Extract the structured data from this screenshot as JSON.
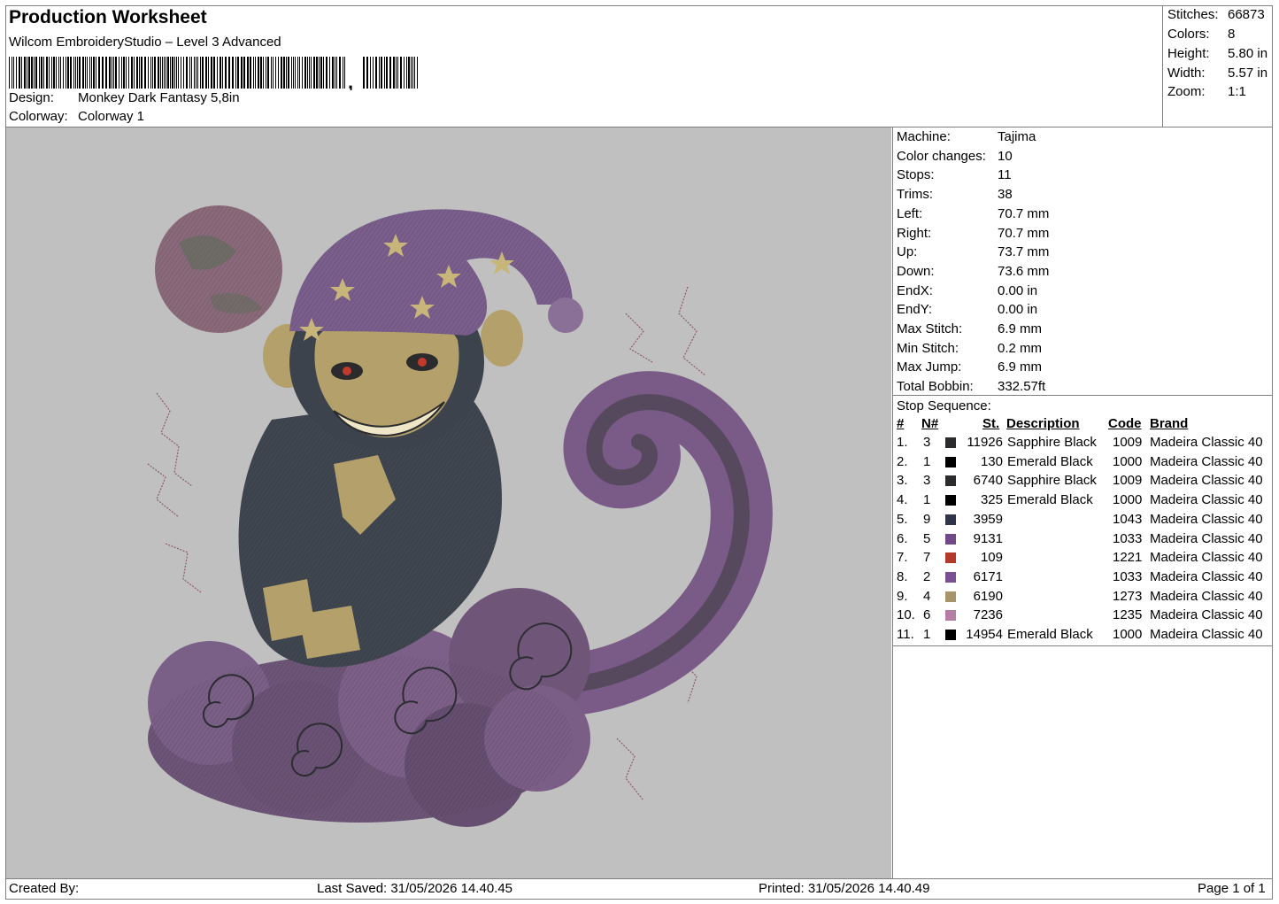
{
  "header": {
    "title": "Production Worksheet",
    "software": "Wilcom EmbroideryStudio – Level 3 Advanced",
    "barcode_suffix": ",",
    "design_label": "Design:",
    "design_value": "Monkey Dark Fantasy 5,8in",
    "colorway_label": "Colorway:",
    "colorway_value": "Colorway 1"
  },
  "stats": [
    {
      "label": "Stitches:",
      "value": "66873"
    },
    {
      "label": "Colors:",
      "value": "8"
    },
    {
      "label": "Height:",
      "value": "5.80 in"
    },
    {
      "label": "Width:",
      "value": "5.57 in"
    },
    {
      "label": "Zoom:",
      "value": "1:1"
    }
  ],
  "machine_info": [
    {
      "label": "Machine:",
      "value": "Tajima"
    },
    {
      "label": "Color changes:",
      "value": "10"
    },
    {
      "label": "Stops:",
      "value": "11"
    },
    {
      "label": "Trims:",
      "value": "38"
    },
    {
      "label": "Left:",
      "value": "70.7 mm"
    },
    {
      "label": "Right:",
      "value": "70.7 mm"
    },
    {
      "label": "Up:",
      "value": "73.7 mm"
    },
    {
      "label": "Down:",
      "value": "73.6 mm"
    },
    {
      "label": "EndX:",
      "value": "0.00 in"
    },
    {
      "label": "EndY:",
      "value": "0.00 in"
    },
    {
      "label": "Max Stitch:",
      "value": "6.9 mm"
    },
    {
      "label": "Min Stitch:",
      "value": "0.2 mm"
    },
    {
      "label": "Max Jump:",
      "value": "6.9 mm"
    },
    {
      "label": "Total Bobbin:",
      "value": "332.57ft"
    }
  ],
  "stop_sequence": {
    "title": "Stop Sequence:",
    "columns": {
      "num": "#",
      "needle": "N#",
      "stitches": "St.",
      "description": "Description",
      "code": "Code",
      "brand": "Brand"
    },
    "rows": [
      {
        "num": "1.",
        "needle": "3",
        "color": "#2b2b2e",
        "stitches": "11926",
        "description": "Sapphire Black",
        "code": "1009",
        "brand": "Madeira Classic 40"
      },
      {
        "num": "2.",
        "needle": "1",
        "color": "#000000",
        "stitches": "130",
        "description": "Emerald Black",
        "code": "1000",
        "brand": "Madeira Classic 40"
      },
      {
        "num": "3.",
        "needle": "3",
        "color": "#2b2b2e",
        "stitches": "6740",
        "description": "Sapphire Black",
        "code": "1009",
        "brand": "Madeira Classic 40"
      },
      {
        "num": "4.",
        "needle": "1",
        "color": "#000000",
        "stitches": "325",
        "description": "Emerald Black",
        "code": "1000",
        "brand": "Madeira Classic 40"
      },
      {
        "num": "5.",
        "needle": "9",
        "color": "#2f3446",
        "stitches": "3959",
        "description": "",
        "code": "1043",
        "brand": "Madeira Classic 40"
      },
      {
        "num": "6.",
        "needle": "5",
        "color": "#6f4a86",
        "stitches": "9131",
        "description": "",
        "code": "1033",
        "brand": "Madeira Classic 40"
      },
      {
        "num": "7.",
        "needle": "7",
        "color": "#b23a2c",
        "stitches": "109",
        "description": "",
        "code": "1221",
        "brand": "Madeira Classic 40"
      },
      {
        "num": "8.",
        "needle": "2",
        "color": "#7a4f94",
        "stitches": "6171",
        "description": "",
        "code": "1033",
        "brand": "Madeira Classic 40"
      },
      {
        "num": "9.",
        "needle": "4",
        "color": "#a8946a",
        "stitches": "6190",
        "description": "",
        "code": "1273",
        "brand": "Madeira Classic 40"
      },
      {
        "num": "10.",
        "needle": "6",
        "color": "#b57fa3",
        "stitches": "7236",
        "description": "",
        "code": "1235",
        "brand": "Madeira Classic 40"
      },
      {
        "num": "11.",
        "needle": "1",
        "color": "#000000",
        "stitches": "14954",
        "description": "Emerald Black",
        "code": "1000",
        "brand": "Madeira Classic 40"
      }
    ]
  },
  "footer": {
    "created_by": "Created By:",
    "last_saved": "Last Saved: 31/05/2026 14.40.45",
    "printed": "Printed: 31/05/2026 14.40.49",
    "page": "Page 1 of 1"
  }
}
